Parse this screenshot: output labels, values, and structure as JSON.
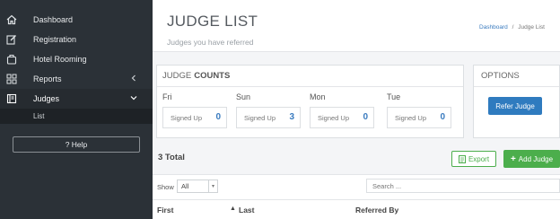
{
  "sidebar": {
    "items": [
      {
        "label": "Dashboard",
        "icon": "home-icon"
      },
      {
        "label": "Registration",
        "icon": "edit-icon"
      },
      {
        "label": "Hotel Rooming",
        "icon": "suitcase-icon"
      },
      {
        "label": "Reports",
        "icon": "grid-icon"
      },
      {
        "label": "Judges",
        "icon": "book-icon"
      }
    ],
    "sub_items": [
      {
        "label": "List"
      }
    ],
    "help_label": "? Help"
  },
  "header": {
    "title": "JUDGE LIST",
    "subtitle": "Judges you have referred",
    "breadcrumb": {
      "home": "Dashboard",
      "separator": "/",
      "current": "Judge List"
    }
  },
  "counts": {
    "title_prefix": "JUDGE",
    "title_bold": "COUNTS",
    "days": [
      {
        "name": "Fri",
        "label": "Signed Up",
        "count": "0"
      },
      {
        "name": "Sun",
        "label": "Signed Up",
        "count": "3"
      },
      {
        "name": "Mon",
        "label": "Signed Up",
        "count": "0"
      },
      {
        "name": "Tue",
        "label": "Signed Up",
        "count": "0"
      }
    ]
  },
  "options": {
    "title": "OPTIONS",
    "refer_button": "Refer Judge"
  },
  "table": {
    "total": "3 Total",
    "export_label": "Export",
    "add_label": "Add Judge",
    "show_label": "Show",
    "show_value": "All",
    "search_placeholder": "Search ...",
    "columns": [
      "First",
      "Last",
      "Referred By"
    ]
  },
  "colors": {
    "sidebar_bg": "#2b3137",
    "primary": "#2f7bbf",
    "success": "#4cae4c"
  }
}
